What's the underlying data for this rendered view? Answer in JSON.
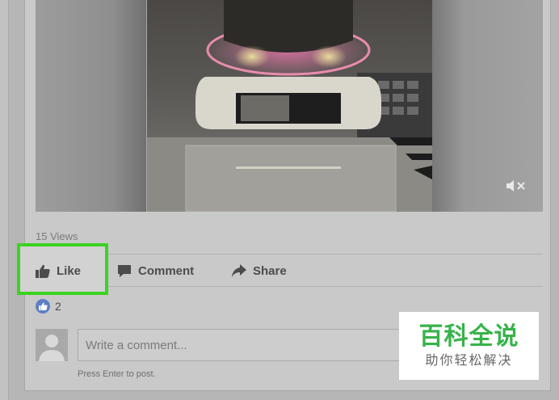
{
  "post": {
    "views_text": "15 Views",
    "reaction_count": "2"
  },
  "actions": {
    "like_label": "Like",
    "comment_label": "Comment",
    "share_label": "Share"
  },
  "comment": {
    "placeholder": "Write a comment...",
    "hint": "Press Enter to post."
  },
  "watermark": {
    "title": "百科全说",
    "subtitle": "助你轻松解决"
  },
  "colors": {
    "highlight": "#3bd321",
    "like_blue": "#5d80c4",
    "watermark_green": "#37b34a"
  },
  "icons": {
    "mute": "speaker-muted-icon",
    "like": "thumbs-up-icon",
    "comment": "speech-bubble-icon",
    "share": "share-arrow-icon",
    "reaction": "like-reaction-icon",
    "avatar": "default-avatar-icon"
  }
}
